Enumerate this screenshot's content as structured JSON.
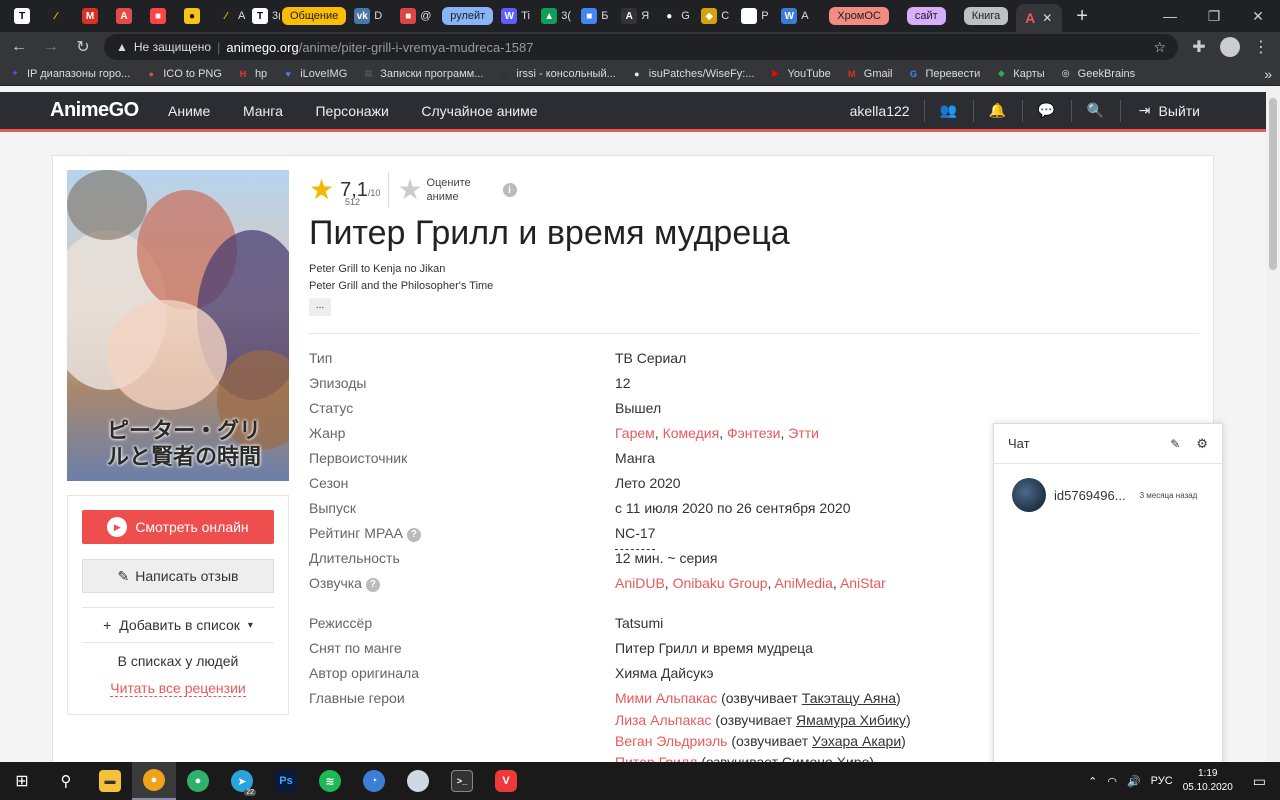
{
  "browser": {
    "tabs": [
      {
        "fav": "T",
        "color": "#ffffff",
        "fg": "#000"
      },
      {
        "fav": "∕",
        "color": "#222",
        "fg": "#f5c518"
      },
      {
        "fav": "M",
        "color": "#d93025",
        "fg": "#fff"
      },
      {
        "fav": "A",
        "color": "#e84a4a",
        "fg": "#fff"
      },
      {
        "fav": "■",
        "color": "#f44",
        "fg": "#fff"
      },
      {
        "fav": "●",
        "color": "#f5c518",
        "fg": "#000"
      },
      {
        "fav": "∕",
        "color": "#222",
        "fg": "#f5c518",
        "label": "A"
      },
      {
        "fav": "T",
        "color": "#ffffff",
        "fg": "#000",
        "label": "3("
      }
    ],
    "group1": {
      "label": "Общение",
      "color": "#fbbc04"
    },
    "group1_tabs": [
      {
        "fav": "vk",
        "color": "#4a76a8",
        "label": "D"
      },
      {
        "fav": "■",
        "color": "#d44",
        "label": "@"
      }
    ],
    "group2": {
      "label": "рулейт",
      "color": "#8ab4f8"
    },
    "group2_tabs": [
      {
        "fav": "W",
        "color": "#5e5eff",
        "label": "Ti"
      },
      {
        "fav": "▲",
        "color": "#0f9d58",
        "label": "3("
      },
      {
        "fav": "■",
        "color": "#4285f4",
        "label": "Б"
      },
      {
        "fav": "A",
        "color": "#333",
        "label": "Я"
      },
      {
        "fav": "●",
        "color": "#222",
        "label": "G"
      },
      {
        "fav": "◆",
        "color": "#d4a20c",
        "label": "C"
      },
      {
        "fav": "▣",
        "color": "#fff",
        "label": "P"
      },
      {
        "fav": "W",
        "color": "#3a7bd5",
        "label": "A"
      }
    ],
    "group3": {
      "label": "ХромОС",
      "color": "#f28b82"
    },
    "group4": {
      "label": "сайт",
      "color": "#d7aefb"
    },
    "group5": {
      "label": "Книга",
      "color": "#bdc1c6"
    },
    "active_tab_fav": "A",
    "new_tab": "+",
    "url_warning": "Не защищено",
    "url_host": "animego.org",
    "url_path": "/anime/piter-grill-i-vremya-mudreca-1587"
  },
  "bookmarks": [
    {
      "label": "IP диапазоны горо...",
      "icon": "✦",
      "color": "#7b3ff2"
    },
    {
      "label": "ICO to PNG",
      "icon": "●",
      "color": "#e04a4a"
    },
    {
      "label": "hp",
      "icon": "H",
      "color": "#e33"
    },
    {
      "label": "iLoveIMG",
      "icon": "♥",
      "color": "#4a7bef"
    },
    {
      "label": "Записки программ...",
      "icon": "▦",
      "color": "#555"
    },
    {
      "label": "irssi - консольный...",
      "icon": "■",
      "color": "#333"
    },
    {
      "label": "isuPatches/WiseFy:...",
      "icon": "●",
      "color": "#eee"
    },
    {
      "label": "YouTube",
      "icon": "▶",
      "color": "#f00"
    },
    {
      "label": "Gmail",
      "icon": "M",
      "color": "#d93025"
    },
    {
      "label": "Перевести",
      "icon": "G",
      "color": "#4285f4"
    },
    {
      "label": "Карты",
      "icon": "◆",
      "color": "#34a853"
    },
    {
      "label": "GeekBrains",
      "icon": "◎",
      "color": "#eee"
    }
  ],
  "site": {
    "logo": "AnimeGO",
    "menu": [
      "Аниме",
      "Манга",
      "Персонажи",
      "Случайное аниме"
    ],
    "username": "akella122",
    "logout": "Выйти"
  },
  "anime": {
    "rating_value": "7,1",
    "rating_max": "/10",
    "rating_count": "512",
    "rate_prompt": "Оцените аниме",
    "title": "Питер Грилл и время мудреца",
    "alt_title_1": "Peter Grill to Kenja no Jikan",
    "alt_title_2": "Peter Grill and the Philosopher's Time",
    "more": "...",
    "poster_text": "ピーター・グリルと賢者の時間",
    "info": {
      "type_label": "Тип",
      "type": "ТВ Сериал",
      "episodes_label": "Эпизоды",
      "episodes": "12",
      "status_label": "Статус",
      "status": "Вышел",
      "genre_label": "Жанр",
      "genres": [
        "Гарем",
        "Комедия",
        "Фэнтези",
        "Этти"
      ],
      "source_label": "Первоисточник",
      "source": "Манга",
      "season_label": "Сезон",
      "season": "Лето 2020",
      "release_label": "Выпуск",
      "release": "с 11 июля 2020 по 26 сентября 2020",
      "mpaa_label": "Рейтинг MPAA",
      "mpaa": "NC-17",
      "duration_label": "Длительность",
      "duration": "12 мин. ~ серия",
      "dub_label": "Озвучка",
      "dubs": [
        "AniDUB",
        "Onibaku Group",
        "AniMedia",
        "AniStar"
      ],
      "director_label": "Режиссёр",
      "director": "Tatsumi",
      "based_label": "Снят по манге",
      "based": "Питер Грилл и время мудреца",
      "author_label": "Автор оригинала",
      "author": "Хияма Дайсукэ",
      "heroes_label": "Главные герои"
    },
    "heroes": [
      {
        "name": "Мими Альпакас",
        "voiced": "озвучивает",
        "actor": "Такэтацу Аяна"
      },
      {
        "name": "Лиза Альпакас",
        "voiced": "озвучивает",
        "actor": "Ямамура Хибику"
      },
      {
        "name": "Веган Эльдриэль",
        "voiced": "озвучивает",
        "actor": "Уэхара Акари"
      },
      {
        "name": "Питер Грилл",
        "voiced": "озвучивает",
        "actor": "Симоно Хиро"
      }
    ]
  },
  "sidebar": {
    "watch": "Смотреть онлайн",
    "review": "Написать отзыв",
    "add_list": "Добавить в список",
    "in_lists": "В списках у людей",
    "read_reviews": "Читать все рецензии"
  },
  "chat": {
    "title": "Чат",
    "user": "id5769496...",
    "time": "3 месяца назад"
  },
  "taskbar": {
    "lang": "РУС",
    "time": "1:19",
    "date": "05.10.2020",
    "telegram_badge": "22"
  }
}
